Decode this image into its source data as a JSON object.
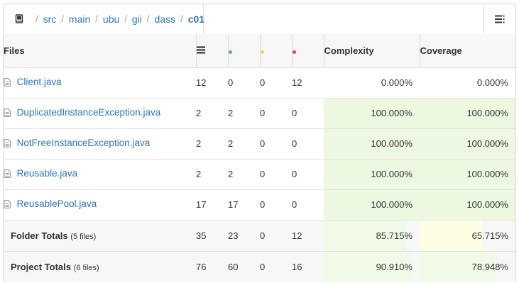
{
  "breadcrumb": {
    "segments": [
      "src",
      "main",
      "ubu",
      "gii",
      "dass"
    ],
    "current": "c01",
    "separator": "/"
  },
  "table": {
    "headers": {
      "files": "Files",
      "complexity": "Complexity",
      "coverage": "Coverage"
    },
    "status_colors": {
      "ok": "#5cb85c",
      "warn": "#f5d33f",
      "bad": "#e8413a"
    },
    "rows": [
      {
        "name": "Client.java",
        "total": "12",
        "ok": "0",
        "warn": "0",
        "bad": "12",
        "complexity": "0.000%",
        "coverage": "0.000%",
        "complexity_level": 0,
        "coverage_level": 0
      },
      {
        "name": "DuplicatedInstanceException.java",
        "total": "2",
        "ok": "2",
        "warn": "0",
        "bad": "0",
        "complexity": "100.000%",
        "coverage": "100.000%",
        "complexity_level": 100,
        "coverage_level": 100
      },
      {
        "name": "NotFreeInstanceException.java",
        "total": "2",
        "ok": "2",
        "warn": "0",
        "bad": "0",
        "complexity": "100.000%",
        "coverage": "100.000%",
        "complexity_level": 100,
        "coverage_level": 100
      },
      {
        "name": "Reusable.java",
        "total": "2",
        "ok": "2",
        "warn": "0",
        "bad": "0",
        "complexity": "100.000%",
        "coverage": "100.000%",
        "complexity_level": 100,
        "coverage_level": 100
      },
      {
        "name": "ReusablePool.java",
        "total": "17",
        "ok": "17",
        "warn": "0",
        "bad": "0",
        "complexity": "100.000%",
        "coverage": "100.000%",
        "complexity_level": 100,
        "coverage_level": 100
      }
    ],
    "totals": [
      {
        "label": "Folder Totals",
        "count": "(5 files)",
        "total": "35",
        "ok": "23",
        "warn": "0",
        "bad": "12",
        "complexity": "85.715%",
        "coverage": "65.715%",
        "complexity_level": 85.715,
        "coverage_level": 65.715
      },
      {
        "label": "Project Totals",
        "count": "(6 files)",
        "total": "76",
        "ok": "60",
        "warn": "0",
        "bad": "16",
        "complexity": "90.910%",
        "coverage": "78.948%",
        "complexity_level": 90.91,
        "coverage_level": 78.948
      }
    ]
  }
}
